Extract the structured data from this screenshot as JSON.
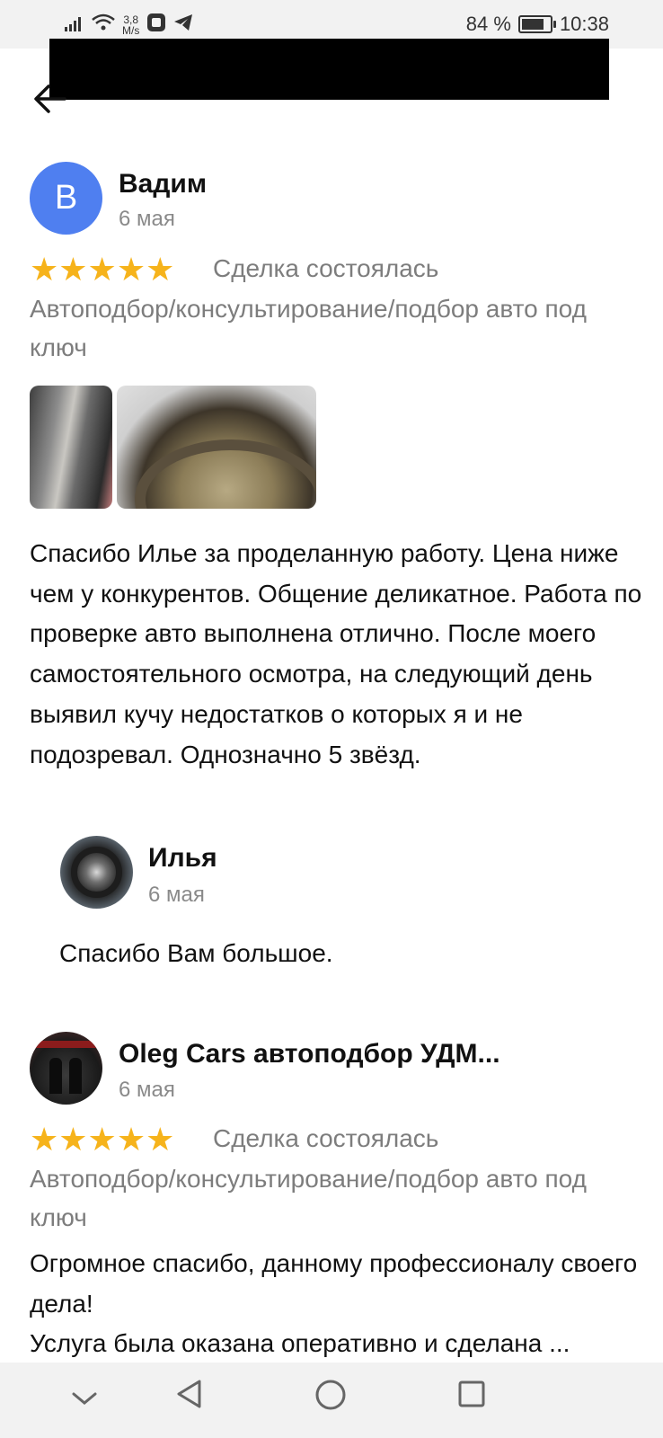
{
  "status_bar": {
    "speed_value": "3,8",
    "speed_unit": "M/s",
    "battery_percent": "84 %",
    "battery_level": 0.84,
    "time": "10:38",
    "icons": [
      "signal-icon",
      "wifi-icon",
      "app-icon",
      "telegram-icon"
    ]
  },
  "header": {
    "back_icon": "arrow-left-icon"
  },
  "reviews": [
    {
      "avatar_letter": "В",
      "avatar_color": "#4f7ff0",
      "author": "Вадим",
      "date": "6 мая",
      "rating": 5,
      "stars": "★★★★★",
      "deal_status": "Сделка состоялась",
      "category": "Автоподбор/консультирование/подбор авто под ключ",
      "text": "Спасибо Илье за проделанную работу. Цена ниже чем у конкурентов. Общение деликатное. Работа по проверке авто выполнена отлично. После моего самостоятельного осмотра, на следующий день выявил кучу недостатков о которых я и не подозревал. Однозначно 5 звёзд.",
      "reply": {
        "author": "Илья",
        "date": "6 мая",
        "text": "Спасибо Вам большое."
      }
    },
    {
      "author": "Oleg Cars автоподбор УДМ...",
      "date": "6 мая",
      "rating": 5,
      "stars": "★★★★★",
      "deal_status": "Сделка состоялась",
      "category": "Автоподбор/консультирование/подбор авто под ключ",
      "text_line1": "Огромное спасибо, данному профессионалу своего дела!",
      "text_line2": "Услуга была оказана оперативно и сделана ..."
    }
  ],
  "colors": {
    "star": "#f6b31b",
    "secondary_text": "#7d7d7d"
  },
  "nav_bar": {
    "icons": [
      "chevron-down-icon",
      "back-triangle-icon",
      "home-circle-icon",
      "recents-square-icon"
    ]
  }
}
